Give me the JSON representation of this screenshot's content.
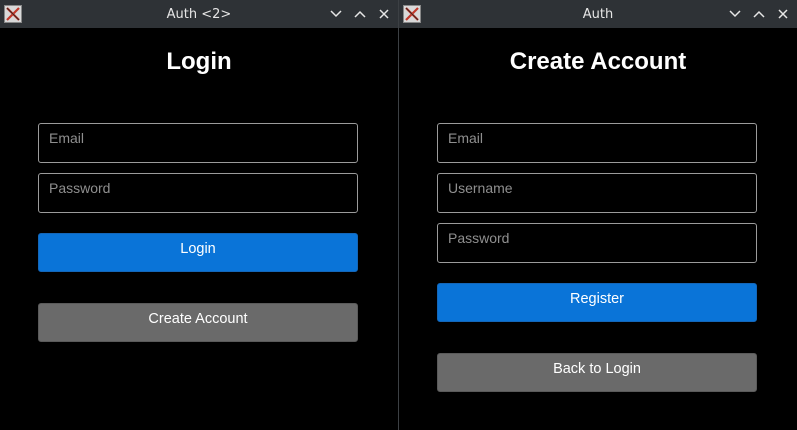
{
  "left_window": {
    "title": "Auth <2>",
    "heading": "Login",
    "email_placeholder": "Email",
    "password_placeholder": "Password",
    "login_label": "Login",
    "create_account_label": "Create Account"
  },
  "right_window": {
    "title": "Auth",
    "heading": "Create Account",
    "email_placeholder": "Email",
    "username_placeholder": "Username",
    "password_placeholder": "Password",
    "register_label": "Register",
    "back_label": "Back to Login"
  },
  "colors": {
    "primary_button": "#0a74d8",
    "secondary_button": "#6a6a6a",
    "titlebar": "#2e3236",
    "background": "#000000"
  },
  "icons": [
    "x11-app-icon",
    "minimize-chevron-icon",
    "maximize-chevron-icon",
    "close-icon"
  ]
}
